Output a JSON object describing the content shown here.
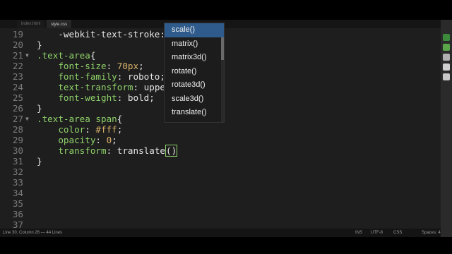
{
  "tabs": [
    {
      "label": "index.html",
      "active": false
    },
    {
      "label": "style.css",
      "active": true
    }
  ],
  "editor": {
    "lines": [
      {
        "num": "19",
        "fold": "",
        "segments": [
          {
            "t": "    -webkit-text-stroke: 2px #fff;",
            "c": "kw"
          }
        ]
      },
      {
        "num": "20",
        "fold": "",
        "segments": [
          {
            "t": "}",
            "c": "kw"
          }
        ]
      },
      {
        "num": "21",
        "fold": "▼",
        "segments": [
          {
            "t": ".text-area",
            "c": "sel"
          },
          {
            "t": "{",
            "c": "kw"
          }
        ]
      },
      {
        "num": "22",
        "fold": "",
        "segments": [
          {
            "t": "    font-size",
            "c": "prop"
          },
          {
            "t": ": ",
            "c": "kw"
          },
          {
            "t": "70px",
            "c": "val"
          },
          {
            "t": ";",
            "c": "kw"
          }
        ]
      },
      {
        "num": "23",
        "fold": "",
        "segments": [
          {
            "t": "    font-family",
            "c": "prop"
          },
          {
            "t": ": roboto;",
            "c": "kw"
          }
        ]
      },
      {
        "num": "24",
        "fold": "",
        "segments": [
          {
            "t": "    text-transform",
            "c": "prop"
          },
          {
            "t": ": upper",
            "c": "kw"
          }
        ]
      },
      {
        "num": "25",
        "fold": "",
        "segments": [
          {
            "t": "    font-weight",
            "c": "prop"
          },
          {
            "t": ": bold;",
            "c": "kw"
          }
        ]
      },
      {
        "num": "26",
        "fold": "",
        "segments": [
          {
            "t": "}",
            "c": "kw"
          }
        ]
      },
      {
        "num": "27",
        "fold": "▼",
        "segments": [
          {
            "t": ".text-area span",
            "c": "sel"
          },
          {
            "t": "{",
            "c": "kw"
          }
        ]
      },
      {
        "num": "28",
        "fold": "",
        "segments": [
          {
            "t": "    color",
            "c": "prop"
          },
          {
            "t": ": ",
            "c": "kw"
          },
          {
            "t": "#fff",
            "c": "val"
          },
          {
            "t": ";",
            "c": "kw"
          }
        ]
      },
      {
        "num": "29",
        "fold": "",
        "segments": [
          {
            "t": "    opacity",
            "c": "prop"
          },
          {
            "t": ": ",
            "c": "kw"
          },
          {
            "t": "0",
            "c": "val"
          },
          {
            "t": ";",
            "c": "kw"
          }
        ]
      },
      {
        "num": "30",
        "fold": "",
        "segments": [
          {
            "t": "    transform",
            "c": "prop"
          },
          {
            "t": ": translate",
            "c": "kw"
          },
          {
            "t": "()",
            "c": "paren"
          }
        ]
      },
      {
        "num": "31",
        "fold": "",
        "segments": [
          {
            "t": "}",
            "c": "kw"
          }
        ]
      },
      {
        "num": "32",
        "fold": "",
        "segments": []
      },
      {
        "num": "33",
        "fold": "",
        "segments": []
      },
      {
        "num": "34",
        "fold": "",
        "segments": []
      },
      {
        "num": "35",
        "fold": "",
        "segments": []
      },
      {
        "num": "36",
        "fold": "",
        "segments": []
      },
      {
        "num": "37",
        "fold": "",
        "segments": []
      }
    ]
  },
  "autocomplete": {
    "items": [
      "scale()",
      "matrix()",
      "matrix3d()",
      "rotate()",
      "rotate3d()",
      "scale3d()",
      "translate()"
    ],
    "selected_index": 0
  },
  "statusbar": {
    "position": "Line 30, Column 26 — 44 Lines",
    "ins": "INS",
    "encoding": "UTF-8",
    "syntax": "CSS",
    "spaces": "Spaces: 4"
  },
  "colors": {
    "accent": "#2f5b8c",
    "selector": "#8fd26a",
    "value": "#d9b26a"
  }
}
